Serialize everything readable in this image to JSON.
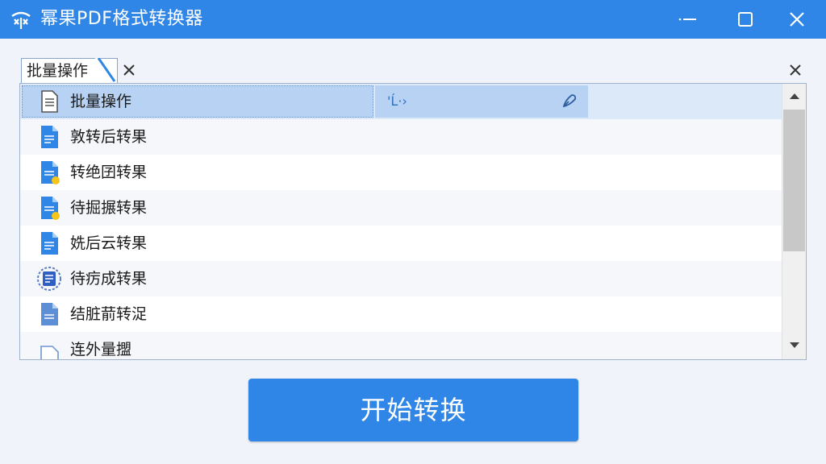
{
  "app": {
    "title": "幂果PDF格式转换器",
    "accent_color": "#2f86e6"
  },
  "window_controls": {
    "minimize_icon": "minimize-icon",
    "maximize_icon": "maximize-icon",
    "close_icon": "close-icon"
  },
  "tab": {
    "label": "批量操作",
    "close_icon": "close-icon"
  },
  "panel": {
    "close_icon": "close-icon"
  },
  "file_list": {
    "items": [
      {
        "label": "批量操作",
        "icon": "document-icon",
        "selected": true
      },
      {
        "label": "敦转后转果",
        "icon": "blue-document-icon"
      },
      {
        "label": "转绝囝转果",
        "icon": "blue-document-yellow-badge-icon"
      },
      {
        "label": "待掘搌转果",
        "icon": "blue-document-yellow-badge-icon"
      },
      {
        "label": "姺后云转果",
        "icon": "blue-document-icon"
      },
      {
        "label": "待疠成转果",
        "icon": "blue-document-badge-icon"
      },
      {
        "label": "结脏葥转浞",
        "icon": "light-blue-document-icon"
      },
      {
        "label": "连外量擝",
        "icon": "outline-document-icon"
      }
    ],
    "selected_row_icons": [
      "edit-cursor-icon",
      "pen-icon"
    ]
  },
  "actions": {
    "start_button_label": "开始转换"
  }
}
